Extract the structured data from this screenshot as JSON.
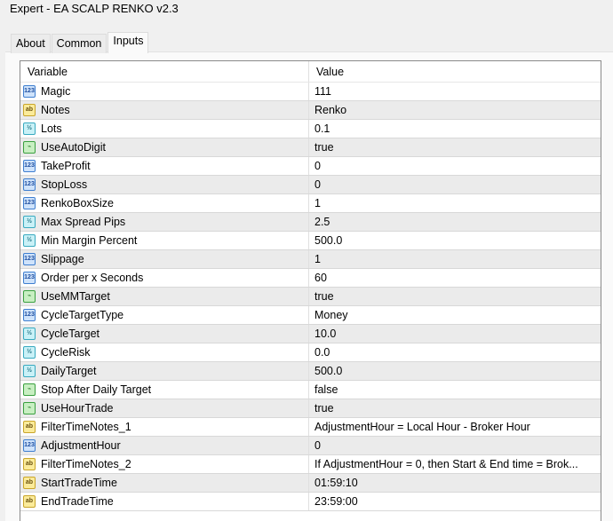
{
  "window": {
    "title": "Expert - EA SCALP RENKO v2.3"
  },
  "tabs": [
    {
      "label": "About"
    },
    {
      "label": "Common"
    },
    {
      "label": "Inputs",
      "active": true
    }
  ],
  "table": {
    "headers": {
      "variable": "Variable",
      "value": "Value"
    },
    "rows": [
      {
        "type": "int",
        "icon": "123",
        "name": "Magic",
        "value": "111"
      },
      {
        "type": "str",
        "icon": "ab",
        "name": "Notes",
        "value": "Renko"
      },
      {
        "type": "dbl",
        "icon": "½",
        "name": "Lots",
        "value": "0.1"
      },
      {
        "type": "bool",
        "icon": "⌁",
        "name": "UseAutoDigit",
        "value": "true"
      },
      {
        "type": "int",
        "icon": "123",
        "name": "TakeProfit",
        "value": "0"
      },
      {
        "type": "int",
        "icon": "123",
        "name": "StopLoss",
        "value": "0"
      },
      {
        "type": "int",
        "icon": "123",
        "name": "RenkoBoxSize",
        "value": "1"
      },
      {
        "type": "dbl",
        "icon": "½",
        "name": "Max Spread Pips",
        "value": "2.5"
      },
      {
        "type": "dbl",
        "icon": "½",
        "name": "Min Margin Percent",
        "value": "500.0"
      },
      {
        "type": "int",
        "icon": "123",
        "name": "Slippage",
        "value": "1"
      },
      {
        "type": "int",
        "icon": "123",
        "name": "Order per x Seconds",
        "value": "60"
      },
      {
        "type": "bool",
        "icon": "⌁",
        "name": "UseMMTarget",
        "value": "true"
      },
      {
        "type": "int",
        "icon": "123",
        "name": "CycleTargetType",
        "value": "Money"
      },
      {
        "type": "dbl",
        "icon": "½",
        "name": "CycleTarget",
        "value": "10.0"
      },
      {
        "type": "dbl",
        "icon": "½",
        "name": "CycleRisk",
        "value": "0.0"
      },
      {
        "type": "dbl",
        "icon": "½",
        "name": "DailyTarget",
        "value": "500.0"
      },
      {
        "type": "bool",
        "icon": "⌁",
        "name": "Stop After Daily Target",
        "value": "false"
      },
      {
        "type": "bool",
        "icon": "⌁",
        "name": "UseHourTrade",
        "value": "true"
      },
      {
        "type": "str",
        "icon": "ab",
        "name": "FilterTimeNotes_1",
        "value": "AdjustmentHour = Local Hour - Broker Hour"
      },
      {
        "type": "int",
        "icon": "123",
        "name": "AdjustmentHour",
        "value": "0"
      },
      {
        "type": "str",
        "icon": "ab",
        "name": "FilterTimeNotes_2",
        "value": "If AdjustmentHour = 0, then Start & End time = Brok..."
      },
      {
        "type": "str",
        "icon": "ab",
        "name": "StartTradeTime",
        "value": "01:59:10"
      },
      {
        "type": "str",
        "icon": "ab",
        "name": "EndTradeTime",
        "value": "23:59:00"
      }
    ]
  }
}
